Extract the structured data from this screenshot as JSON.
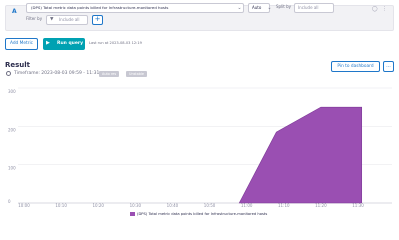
{
  "query": {
    "letter": "A",
    "metric": "(DPS) Total metric data points billed for Infrastructure-monitored hosts",
    "aggregation": "Auto",
    "split_label": "Split by",
    "split_placeholder": "Include all",
    "filter_label": "Filter by",
    "filter_placeholder": "Include all"
  },
  "actions": {
    "add_metric": "Add Metric",
    "run_query": "Run query",
    "last_run": "Last run at 2023-08-03 12:19"
  },
  "result": {
    "title": "Result",
    "timeframe": "Timeframe: 2023-08-03 09:59 - 11:31",
    "tags": [
      "Auto res",
      "Unstable"
    ],
    "pin_button": "Pin to dashboard",
    "more_button": "..."
  },
  "chart_data": {
    "type": "area",
    "x": [
      "10:00",
      "10:10",
      "10:20",
      "10:30",
      "10:40",
      "10:50",
      "11:00",
      "11:10",
      "11:20",
      "11:30"
    ],
    "xlabel": "",
    "ylabel": "",
    "ylim": [
      0,
      300
    ],
    "yticks": [
      0,
      100,
      200,
      300
    ],
    "grid": true,
    "series": [
      {
        "name": "(DPS) Total metric data points billed for Infrastructure-monitored hosts",
        "color": "#9a4fb2",
        "points": [
          {
            "x": "10:58",
            "y": 0
          },
          {
            "x": "11:08",
            "y": 185
          },
          {
            "x": "11:20",
            "y": 250
          },
          {
            "x": "11:31",
            "y": 250
          }
        ]
      }
    ],
    "legend_position": "bottom-center"
  }
}
